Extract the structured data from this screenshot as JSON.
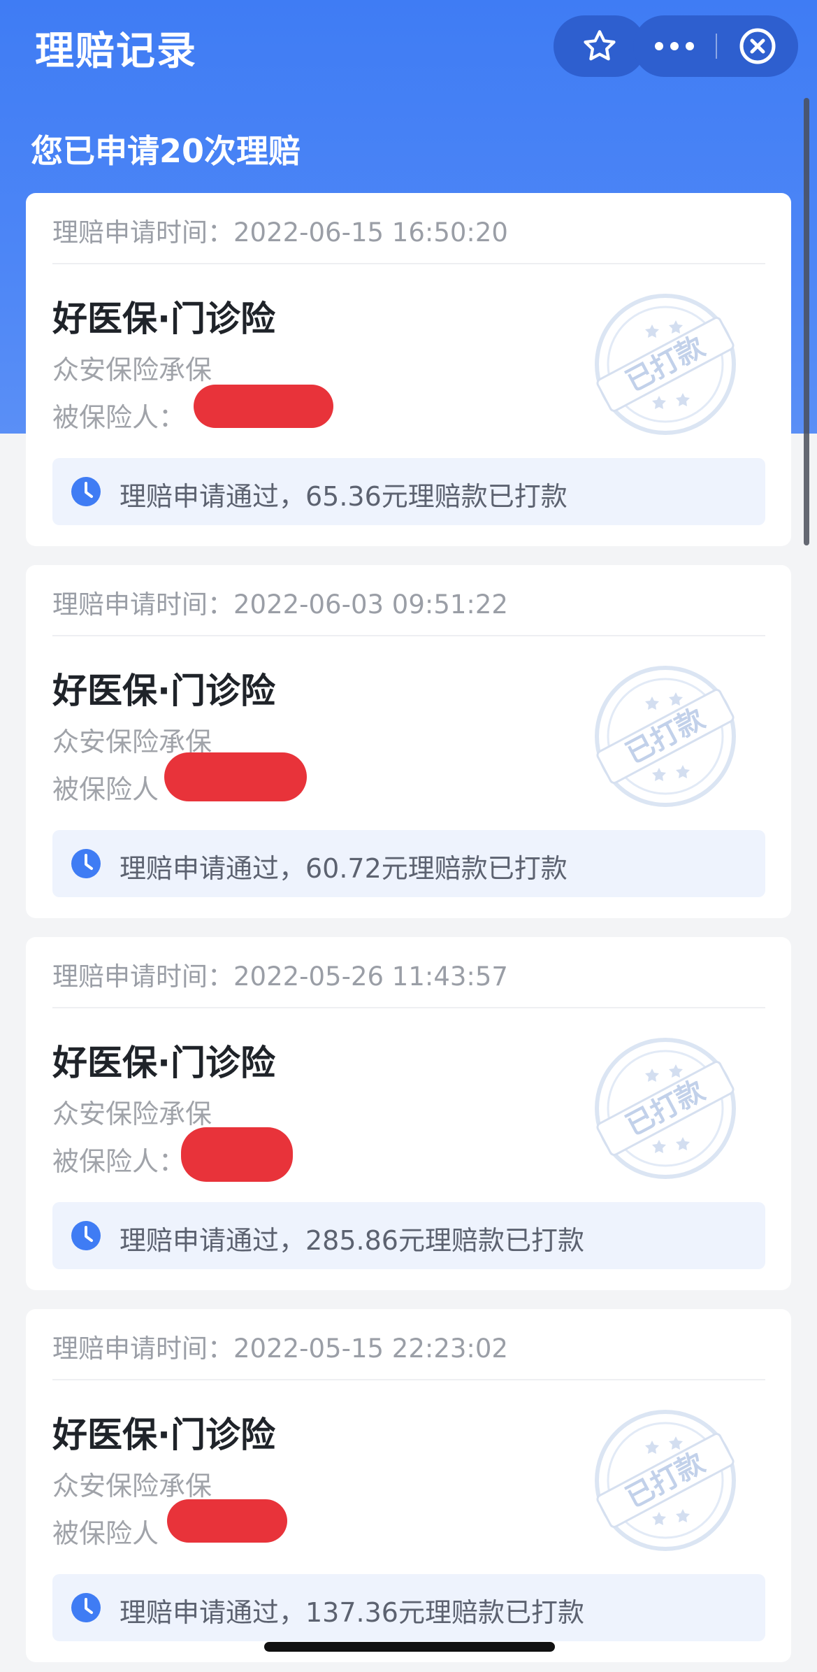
{
  "header": {
    "title": "理赔记录",
    "summary": "您已申请20次理赔"
  },
  "nav_icons": {
    "favorite": "star-icon",
    "more": "more-icon",
    "close": "close-circle-icon"
  },
  "claims": [
    {
      "time_label": "理赔申请时间：",
      "time": "2022-06-15 16:50:20",
      "product": "好医保·门诊险",
      "insurer": "众安保险承保",
      "insured_label": "被保险人：",
      "stamp_text": "已打款",
      "status": "理赔申请通过，65.36元理赔款已打款"
    },
    {
      "time_label": "理赔申请时间：",
      "time": "2022-06-03 09:51:22",
      "product": "好医保·门诊险",
      "insurer": "众安保险承保",
      "insured_label": "被保险人",
      "stamp_text": "已打款",
      "status": "理赔申请通过，60.72元理赔款已打款"
    },
    {
      "time_label": "理赔申请时间：",
      "time": "2022-05-26 11:43:57",
      "product": "好医保·门诊险",
      "insurer": "众安保险承保",
      "insured_label": "被保险人：",
      "stamp_text": "已打款",
      "status": "理赔申请通过，285.86元理赔款已打款"
    },
    {
      "time_label": "理赔申请时间：",
      "time": "2022-05-15 22:23:02",
      "product": "好医保·门诊险",
      "insurer": "众安保险承保",
      "insured_label": "被保险人",
      "stamp_text": "已打款",
      "status": "理赔申请通过，137.36元理赔款已打款"
    }
  ],
  "colors": {
    "header_blue": "#3f7cf4",
    "capsule_blue": "#2e5fcf",
    "redaction_red": "#e8333a",
    "status_bg": "#eef3fd",
    "clock_blue": "#3f7cf4"
  }
}
